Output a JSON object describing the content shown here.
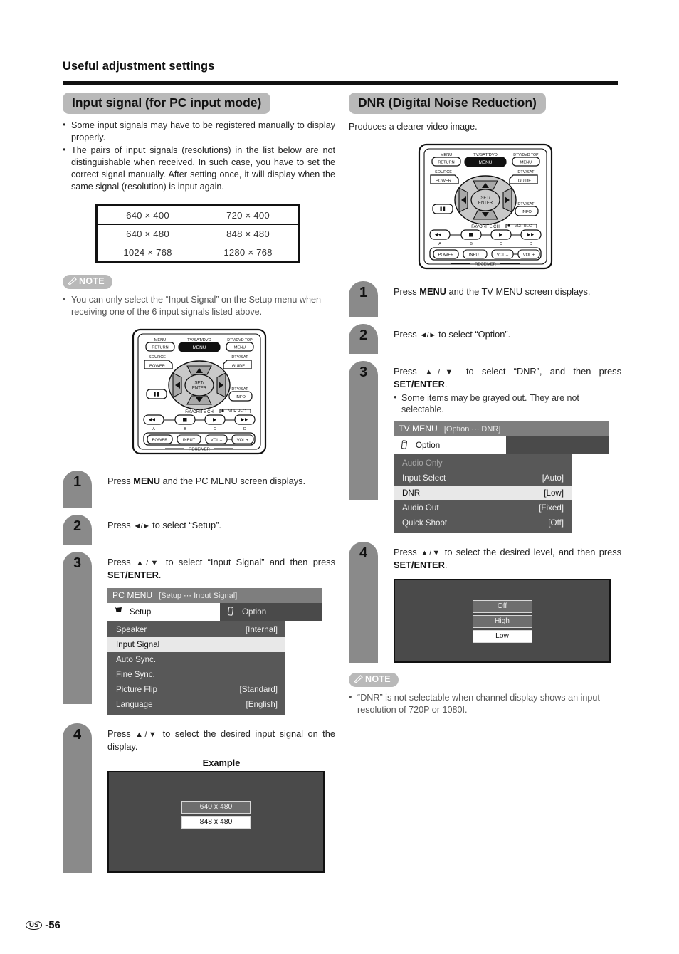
{
  "header": {
    "section_title": "Useful adjustment settings"
  },
  "left": {
    "title": "Input signal (for PC input mode)",
    "bullets": [
      "Some input signals may have to be registered manually to display properly.",
      "The pairs of input signals (resolutions) in the list below are not distinguishable when received. In such case, you have to set the correct signal manually. After setting once, it will display when the same signal (resolution) is input again."
    ],
    "resolution_table": {
      "rows": [
        [
          "640 × 400",
          "720 × 400"
        ],
        [
          "640 × 480",
          "848 × 480"
        ],
        [
          "1024 × 768",
          "1280 × 768"
        ]
      ]
    },
    "note": {
      "label": "NOTE",
      "items": [
        "You can only select the “Input Signal” on the Setup menu when receiving one of the 6 input signals listed above."
      ]
    },
    "steps": [
      {
        "num": "1",
        "text_html": "Press <b>MENU</b> and the PC MENU screen displays."
      },
      {
        "num": "2",
        "text_html": "Press <span class=\"arrows\">◄/►</span> to select “Setup”."
      },
      {
        "num": "3",
        "text_html": "Press <span class=\"arrows\">▲/▼</span> to select “Input Signal” and then press <b>SET/ENTER</b>."
      },
      {
        "num": "4",
        "text_html": "Press <span class=\"arrows\">▲/▼</span> to select the desired input signal on the display."
      }
    ],
    "osd": {
      "title": "PC MENU",
      "context": "[Setup ⋯ Input Signal]",
      "tabs": [
        {
          "label": "Setup",
          "icon": "setup-icon",
          "glyph": "✇",
          "active": true
        },
        {
          "label": "Option",
          "icon": "option-icon",
          "glyph": "❑",
          "active": false
        }
      ],
      "rows": [
        {
          "label": "Speaker",
          "value": "[Internal]",
          "state": "normal"
        },
        {
          "label": "Input Signal",
          "value": "",
          "state": "selected"
        },
        {
          "label": "Auto Sync.",
          "value": "",
          "state": "normal"
        },
        {
          "label": "Fine Sync.",
          "value": "",
          "state": "normal"
        },
        {
          "label": "Picture Flip",
          "value": "[Standard]",
          "state": "normal"
        },
        {
          "label": "Language",
          "value": "[English]",
          "state": "normal"
        }
      ]
    },
    "example": {
      "label": "Example",
      "options": [
        {
          "label": "640 x 480",
          "selected": false
        },
        {
          "label": "848 x 480",
          "selected": true
        }
      ]
    }
  },
  "right": {
    "title": "DNR (Digital Noise Reduction)",
    "lead": "Produces a clearer video image.",
    "steps": [
      {
        "num": "1",
        "text_html": "Press <b>MENU</b> and the TV MENU screen displays."
      },
      {
        "num": "2",
        "text_html": "Press <span class=\"arrows\">◄/►</span> to select “Option”."
      },
      {
        "num": "3",
        "text_html": "Press <span class=\"arrows\">▲/▼</span> to select “DNR”, and then press <b>SET/ENTER</b>."
      },
      {
        "num": "4",
        "text_html": "Press <span class=\"arrows\">▲/▼</span> to select the desired level, and then press <b>SET/ENTER</b>."
      }
    ],
    "step3_subnote": "Some items may be grayed out. They are not selectable.",
    "osd": {
      "title": "TV MENU",
      "context": "[Option ⋯ DNR]",
      "tabs": [
        {
          "label": "Option",
          "icon": "option-icon",
          "glyph": "❑",
          "active": true
        },
        {
          "label": "",
          "icon": "blank-tab",
          "glyph": "",
          "active": false
        }
      ],
      "rows": [
        {
          "label": "Audio Only",
          "value": "",
          "state": "dim"
        },
        {
          "label": "Input Select",
          "value": "[Auto]",
          "state": "normal"
        },
        {
          "label": "DNR",
          "value": "[Low]",
          "state": "selected"
        },
        {
          "label": "Audio Out",
          "value": "[Fixed]",
          "state": "normal"
        },
        {
          "label": "Quick Shoot",
          "value": "[Off]",
          "state": "normal"
        }
      ]
    },
    "level_screen": {
      "options": [
        {
          "label": "Off",
          "selected": false
        },
        {
          "label": "High",
          "selected": false
        },
        {
          "label": "Low",
          "selected": true
        }
      ]
    },
    "note": {
      "label": "NOTE",
      "items": [
        "“DNR” is not selectable when channel display shows an input resolution of 720P or 1080I."
      ]
    }
  },
  "remote": {
    "labels": {
      "menu_small": "MENU",
      "return": "RETURN",
      "tvsatdvd": "TV/SAT/DVD",
      "menu_big": "MENU",
      "dtvdvdtop": "DTV/DVD TOP",
      "menu_right": "MENU",
      "source": "SOURCE",
      "power": "POWER",
      "dtvsat_guide": "DTV/SAT",
      "guide": "GUIDE",
      "set_enter_1": "SET/",
      "set_enter_2": "ENTER",
      "dtvsat_info": "DTV/SAT",
      "info": "INFO",
      "favorite_ch": "FAVORITE CH",
      "vcr_rec": "VCR REC",
      "a": "A",
      "b": "B",
      "c": "C",
      "d": "D",
      "receiver_power": "POWER",
      "input": "INPUT",
      "vol_minus": "VOL –",
      "vol_plus": "VOL +",
      "receiver": "RECEIVER"
    }
  },
  "footer": {
    "region": "US",
    "page": "-56"
  }
}
